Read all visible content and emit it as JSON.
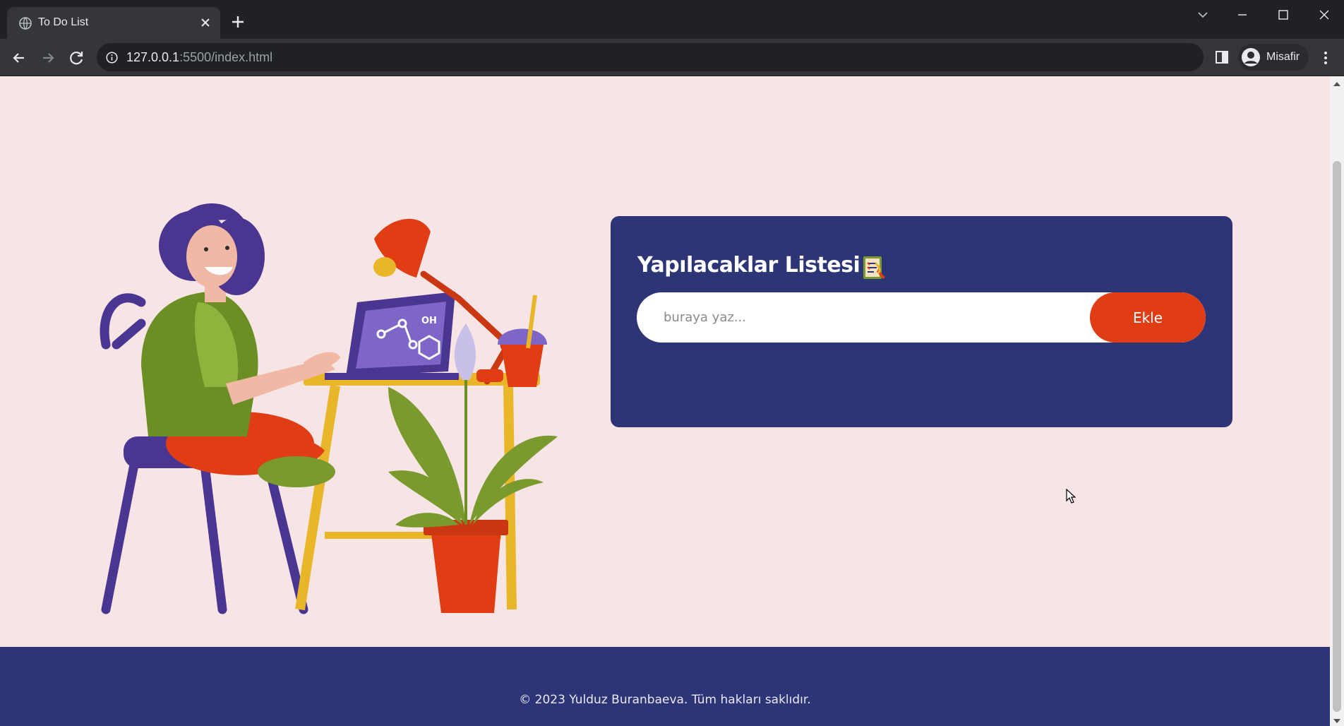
{
  "browser": {
    "tab_title": "To Do List",
    "url_host": "127.0.0.1",
    "url_rest": ":5500/index.html",
    "profile_name": "Misafir",
    "icons": [
      "globe-icon",
      "close-icon",
      "plus-icon",
      "chevron-down-icon",
      "minimize-icon",
      "maximize-icon",
      "window-close-icon",
      "back-arrow-icon",
      "forward-arrow-icon",
      "reload-icon",
      "info-icon",
      "side-panel-icon",
      "avatar-icon",
      "more-vert-icon"
    ]
  },
  "todo": {
    "title": "Yapılacaklar Listesi",
    "input_placeholder": "buraya yaz...",
    "add_label": "Ekle"
  },
  "footer": {
    "text": "© 2023 Yulduz Buranbaeva. Tüm hakları saklıdır."
  },
  "colors": {
    "page_background": "#f7e5e6",
    "card_background": "#2d3577",
    "accent": "#e03d14",
    "footer_background": "#2d3577"
  }
}
